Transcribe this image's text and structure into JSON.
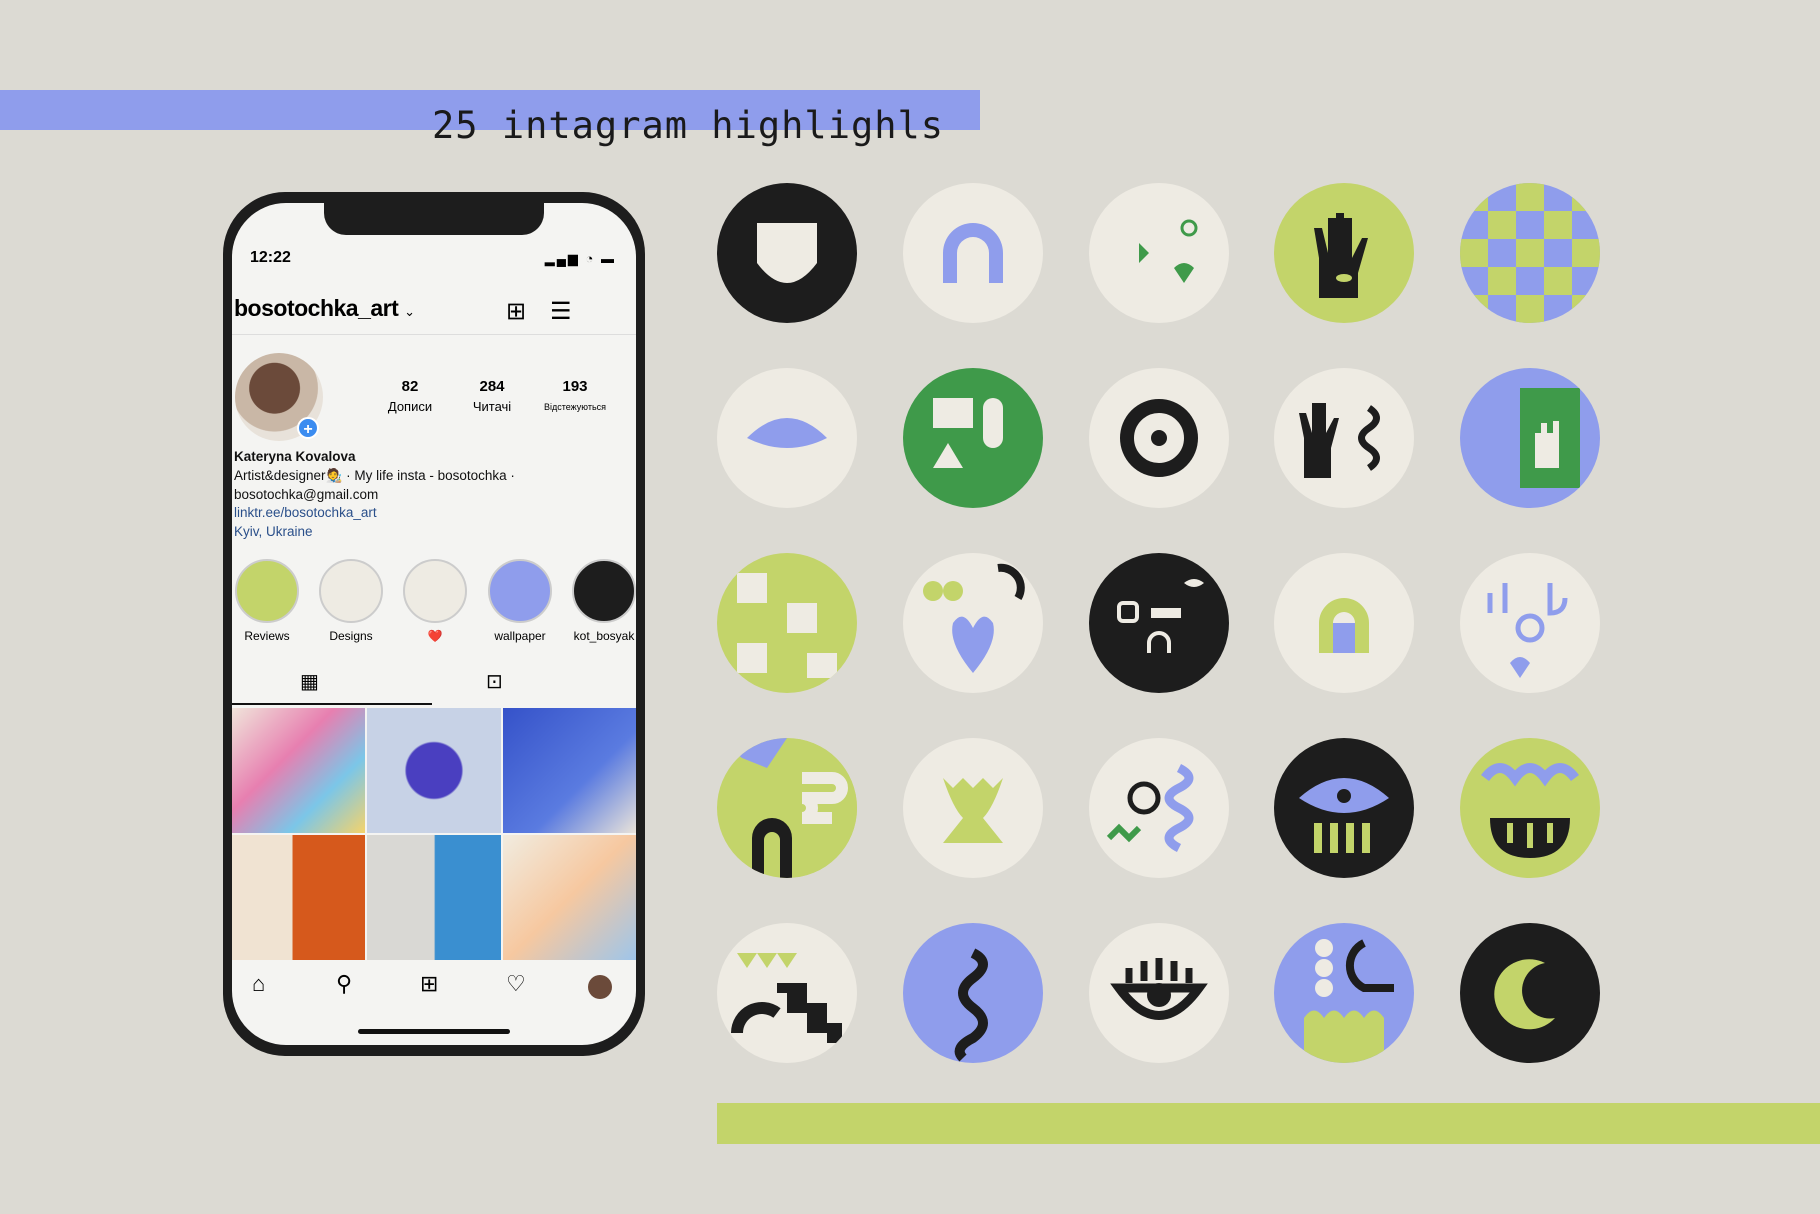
{
  "title": "25 intagram highlighls",
  "colors": {
    "background": "#dcdad3",
    "blue": "#8f9dec",
    "green": "#c3d46a",
    "black": "#1d1d1d",
    "cream": "#eeebe3",
    "darkgreen": "#3f9a4a"
  },
  "phone": {
    "status": {
      "time": "12:22",
      "icons": "signal-wifi-battery"
    },
    "header": {
      "username": "bosotochka_art",
      "dropdown_icon": "chevron-down-icon",
      "new_post_icon": "plus-square-icon",
      "menu_icon": "hamburger-icon"
    },
    "stats": [
      {
        "value": "82",
        "label": "Дописи"
      },
      {
        "value": "284",
        "label": "Читачі"
      },
      {
        "value": "193",
        "label": "Відстежуються"
      }
    ],
    "profile": {
      "name": "Kateryna Kovalova",
      "bio_line1": "Artist&designer🧑‍🎨 · My life insta - bosotochka ·",
      "bio_line2": "bosotochka@gmail.com",
      "link": "linktr.ee/bosotochka_art",
      "location": "Kyiv, Ukraine"
    },
    "highlights": [
      {
        "label": "Reviews",
        "bg": "#c3d46a"
      },
      {
        "label": "Designs",
        "bg": "#eeebe3"
      },
      {
        "label": "❤️",
        "bg": "#eeebe3"
      },
      {
        "label": "wallpaper",
        "bg": "#8f9dec"
      },
      {
        "label": "kot_bosyak",
        "bg": "#1d1d1d"
      }
    ],
    "tabs": {
      "grid_icon": "grid-icon",
      "tagged_icon": "tagged-icon"
    },
    "posts": [
      "#e9c9b8",
      "#4a3fc0",
      "#3552c9",
      "#d6591c",
      "#3a8fd0",
      "#f1ece0"
    ],
    "nav": [
      "home-icon",
      "search-icon",
      "add-icon",
      "heart-icon",
      "profile-icon"
    ]
  },
  "highlight_icons": [
    {
      "name": "hand",
      "bg": "#1d1d1d",
      "fg": "#eeebe3"
    },
    {
      "name": "rainbow",
      "bg": "#eeebe3",
      "fg": "#8f9dec"
    },
    {
      "name": "pattern-green",
      "bg": "#eeebe3",
      "fg": "#3f9a4a"
    },
    {
      "name": "eye-hand",
      "bg": "#c3d46a",
      "fg": "#1d1d1d"
    },
    {
      "name": "checkerboard",
      "bg": "#8f9dec",
      "fg": "#c3d46a"
    },
    {
      "name": "closed-eye",
      "bg": "#eeebe3",
      "fg": "#8f9dec"
    },
    {
      "name": "shapes-green",
      "bg": "#3f9a4a",
      "fg": "#eeebe3"
    },
    {
      "name": "target",
      "bg": "#eeebe3",
      "fg": "#1d1d1d"
    },
    {
      "name": "hand-snake",
      "bg": "#eeebe3",
      "fg": "#1d1d1d"
    },
    {
      "name": "hand-green",
      "bg": "#8f9dec",
      "fg": "#3f9a4a"
    },
    {
      "name": "tiles",
      "bg": "#c3d46a",
      "fg": "#eeebe3"
    },
    {
      "name": "heart",
      "bg": "#eeebe3",
      "fg": "#8f9dec"
    },
    {
      "name": "pattern-black",
      "bg": "#1d1d1d",
      "fg": "#eeebe3"
    },
    {
      "name": "arch",
      "bg": "#eeebe3",
      "fg": "#c3d46a"
    },
    {
      "name": "pattern-blue",
      "bg": "#eeebe3",
      "fg": "#8f9dec"
    },
    {
      "name": "star-arch",
      "bg": "#c3d46a",
      "fg": "#1d1d1d"
    },
    {
      "name": "vase",
      "bg": "#eeebe3",
      "fg": "#c3d46a"
    },
    {
      "name": "doodles",
      "bg": "#eeebe3",
      "fg": "#3f9a4a"
    },
    {
      "name": "eye-comb",
      "bg": "#1d1d1d",
      "fg": "#8f9dec"
    },
    {
      "name": "flower",
      "bg": "#c3d46a",
      "fg": "#1d1d1d"
    },
    {
      "name": "stairs",
      "bg": "#eeebe3",
      "fg": "#1d1d1d"
    },
    {
      "name": "snake",
      "bg": "#8f9dec",
      "fg": "#1d1d1d"
    },
    {
      "name": "eye-lashes",
      "bg": "#eeebe3",
      "fg": "#1d1d1d"
    },
    {
      "name": "wallpaper",
      "bg": "#8f9dec",
      "fg": "#c3d46a"
    },
    {
      "name": "moon",
      "bg": "#1d1d1d",
      "fg": "#c3d46a"
    }
  ]
}
